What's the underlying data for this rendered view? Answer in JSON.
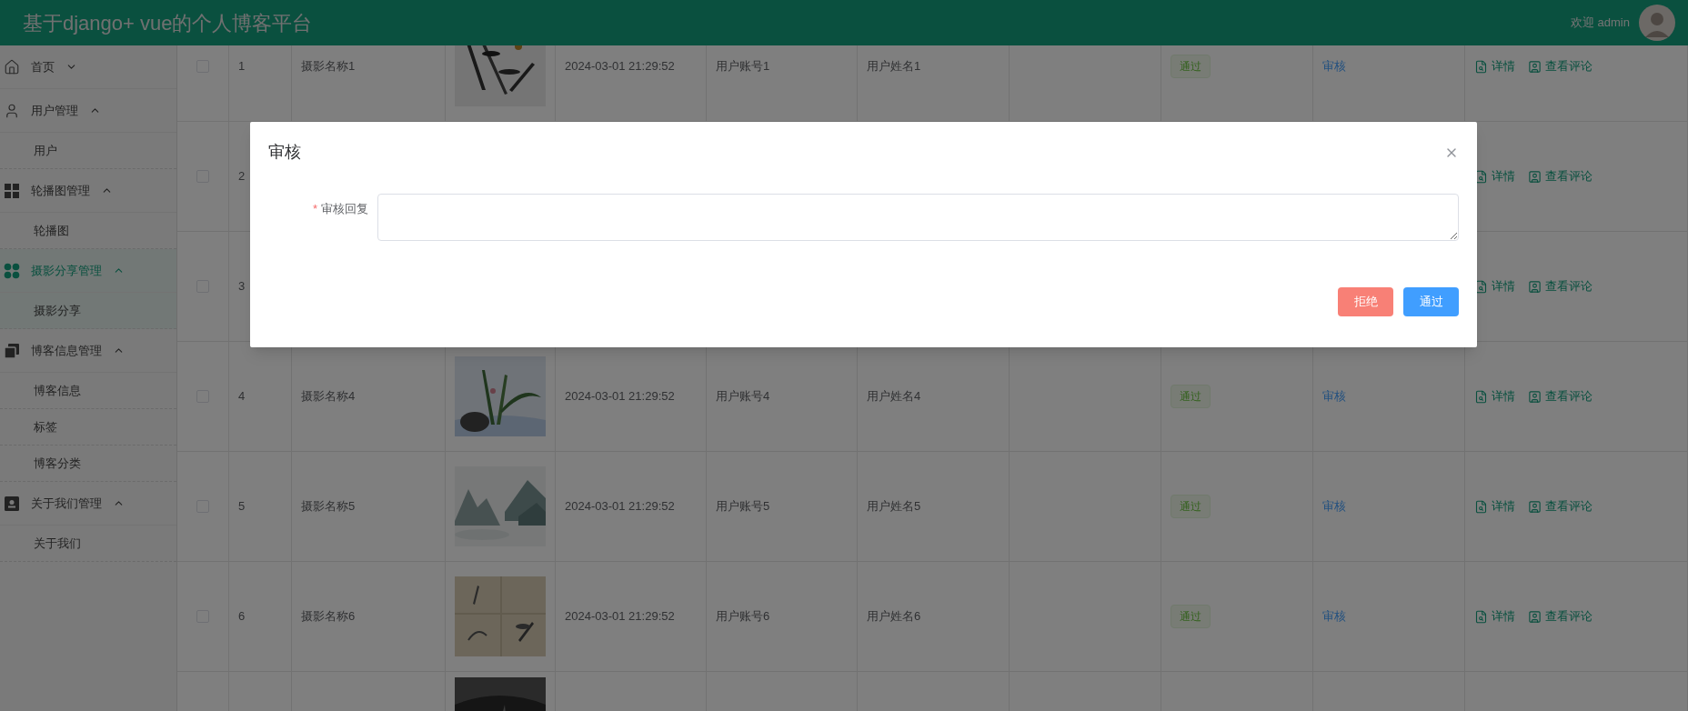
{
  "header": {
    "title": "基于django+ vue的个人博客平台",
    "welcome": "欢迎 admin"
  },
  "sidebar": {
    "items": [
      {
        "label": "首页",
        "expanded": false,
        "selected": false
      },
      {
        "label": "用户管理",
        "expanded": true,
        "selected": false,
        "children": [
          {
            "label": "用户",
            "selected": false
          }
        ]
      },
      {
        "label": "轮播图管理",
        "expanded": true,
        "selected": false,
        "children": [
          {
            "label": "轮播图",
            "selected": false
          }
        ]
      },
      {
        "label": "摄影分享管理",
        "expanded": true,
        "selected": true,
        "children": [
          {
            "label": "摄影分享",
            "selected": true
          }
        ]
      },
      {
        "label": "博客信息管理",
        "expanded": true,
        "selected": false,
        "children": [
          {
            "label": "博客信息",
            "selected": false
          },
          {
            "label": "标签",
            "selected": false
          },
          {
            "label": "博客分类",
            "selected": false
          }
        ]
      },
      {
        "label": "关于我们管理",
        "expanded": true,
        "selected": false,
        "children": [
          {
            "label": "关于我们",
            "selected": false
          }
        ]
      }
    ]
  },
  "table": {
    "rows": [
      {
        "checked": false,
        "index": "1",
        "name": "摄影名称1",
        "image": {
          "kind": "picture"
        },
        "time": "2024-03-01 21:29:52",
        "account": "用户账号1",
        "username": "用户姓名1",
        "status": "通过",
        "review": "审核",
        "actions": [
          "详情",
          "查看评论"
        ]
      },
      {
        "checked": false,
        "index": "2",
        "actions": [
          "详情",
          "查看评论"
        ]
      },
      {
        "checked": false,
        "index": "3",
        "actions": [
          "详情",
          "查看评论"
        ]
      },
      {
        "checked": false,
        "index": "4",
        "name": "摄影名称4",
        "image": {
          "kind": "picture"
        },
        "time": "2024-03-01 21:29:52",
        "account": "用户账号4",
        "username": "用户姓名4",
        "status": "通过",
        "review": "审核",
        "actions": [
          "详情",
          "查看评论"
        ]
      },
      {
        "checked": false,
        "index": "5",
        "name": "摄影名称5",
        "image": {
          "kind": "picture"
        },
        "time": "2024-03-01 21:29:52",
        "account": "用户账号5",
        "username": "用户姓名5",
        "status": "通过",
        "review": "审核",
        "actions": [
          "详情",
          "查看评论"
        ]
      },
      {
        "checked": false,
        "index": "6",
        "name": "摄影名称6",
        "image": {
          "kind": "picture"
        },
        "time": "2024-03-01 21:29:52",
        "account": "用户账号6",
        "username": "用户姓名6",
        "status": "通过",
        "review": "审核",
        "actions": [
          "详情",
          "查看评论"
        ]
      },
      {
        "image": {
          "kind": "picture"
        }
      }
    ]
  },
  "modal": {
    "title": "审核",
    "field": {
      "label": "审核回复",
      "required_mark": "*"
    },
    "buttons": [
      {
        "label": "拒绝",
        "kind": "danger"
      },
      {
        "label": "通过",
        "kind": "primary"
      }
    ]
  }
}
